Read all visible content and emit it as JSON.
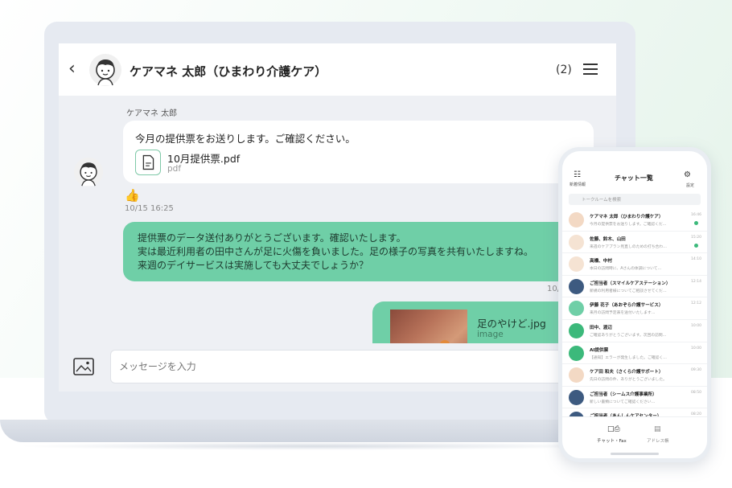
{
  "laptop": {
    "header": {
      "back_icon": "chevron-left-icon",
      "title": "ケアマネ 太郎（ひまわり介護ケア）",
      "count": "(2)",
      "menu_icon": "hamburger-menu-icon"
    },
    "messages": {
      "incoming": {
        "sender": "ケアマネ 太郎",
        "text": "今月の提供票をお送りします。ご確認ください。",
        "file_name": "10月提供票.pdf",
        "file_type": "pdf",
        "reaction": "👍",
        "time": "10/15 16:25"
      },
      "outgoing": {
        "line1": "提供票のデータ送付ありがとうございます。確認いたします。",
        "line2": "実は最近利用者の田中さんが足に火傷を負いました。足の様子の写真を共有いたしますね。",
        "line3": "来週のデイサービスは実施しても大丈夫でしょうか？",
        "time": "10/"
      },
      "image": {
        "file_name": "足のやけど.jpg",
        "file_type": "image"
      }
    },
    "input": {
      "image_icon": "image-icon",
      "placeholder": "メッセージを入力"
    }
  },
  "phone": {
    "top_left_label": "新着情報",
    "title": "チャット一覧",
    "top_right_label": "設定",
    "search_placeholder": "トークルームを検索",
    "rows": [
      {
        "name": "ケアマネ 太郎（ひまわり介護ケア）",
        "preview": "今月の提供票をお送りします。ご確認くだ…",
        "time": "16:46",
        "unread": true,
        "color": "#f3d9c4"
      },
      {
        "name": "佐藤、鈴木、山田",
        "preview": "来週のケアプラン見直しのための打ち合わ…",
        "time": "15:20",
        "unread": true,
        "color": "#f5e3d3"
      },
      {
        "name": "高橋、中村",
        "preview": "本日の訪問時に、Aさんの体調について…",
        "time": "14:10",
        "unread": false,
        "color": "#f5e3d3"
      },
      {
        "name": "ご担当者（スマイルケアステーション）",
        "preview": "新規の利用者様についてご相談させてくだ…",
        "time": "12:14",
        "unread": false,
        "color": "#3d5a80"
      },
      {
        "name": "伊藤 花子（あおぞら介護サービス）",
        "preview": "来月の訪問予定表を送付いたします…",
        "time": "12:12",
        "unread": false,
        "color": "#6fcfa7"
      },
      {
        "name": "田中、渡辺",
        "preview": "ご確認ありがとうございます。次回の訪問…",
        "time": "10:00",
        "unread": false,
        "color": "#3cb97b"
      },
      {
        "name": "AI提供票",
        "preview": "【通知】エラーが発生しました。ご確認く…",
        "time": "10:00",
        "unread": false,
        "color": "#3cb97b"
      },
      {
        "name": "ケア田 和夫（さくら介護サポート）",
        "preview": "先日の訪問の件、ありがとうございました。",
        "time": "09:30",
        "unread": false,
        "color": "#f3d9c4"
      },
      {
        "name": "ご担当者（シームス介護事業所）",
        "preview": "新しい書類についてご確認ください…",
        "time": "08:50",
        "unread": false,
        "color": "#3d5a80"
      },
      {
        "name": "ご担当者（あんしんケアセンター）",
        "preview": "",
        "time": "08:20",
        "unread": false,
        "color": "#3d5a80"
      }
    ],
    "tabs": {
      "chat_label": "チャット・Fax",
      "address_label": "アドレス帳"
    }
  }
}
